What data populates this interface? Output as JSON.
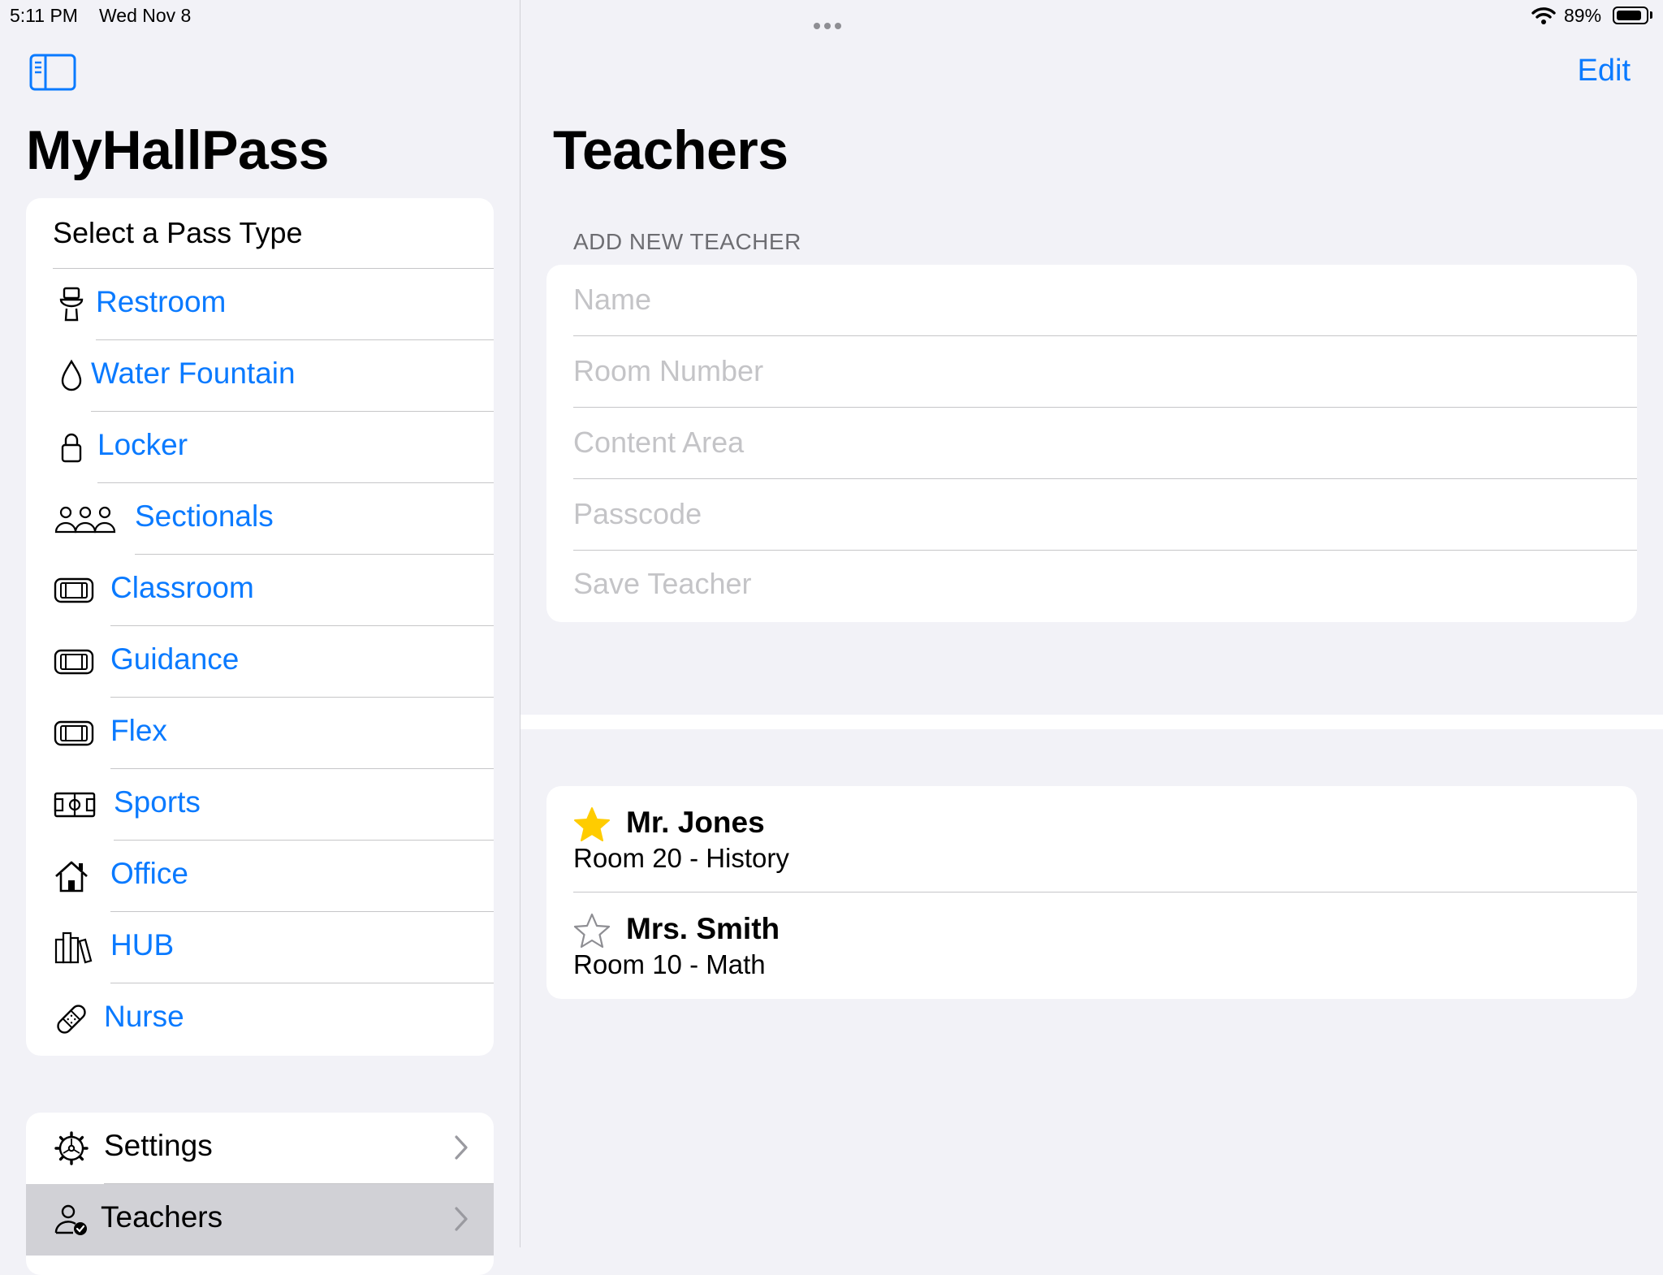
{
  "status_bar": {
    "time": "5:11 PM",
    "date": "Wed Nov 8",
    "battery_pct": "89%",
    "battery_level": 0.89
  },
  "sidebar": {
    "app_title": "MyHallPass",
    "pass_header": "Select a Pass Type",
    "pass_types": [
      {
        "label": "Restroom",
        "icon": "toilet-icon"
      },
      {
        "label": "Water Fountain",
        "icon": "drop-icon"
      },
      {
        "label": "Locker",
        "icon": "lock-icon"
      },
      {
        "label": "Sectionals",
        "icon": "group-icon"
      },
      {
        "label": "Classroom",
        "icon": "film-icon"
      },
      {
        "label": "Guidance",
        "icon": "film-icon"
      },
      {
        "label": "Flex",
        "icon": "film-icon"
      },
      {
        "label": "Sports",
        "icon": "sports-court-icon"
      },
      {
        "label": "Office",
        "icon": "house-icon"
      },
      {
        "label": "HUB",
        "icon": "books-icon"
      },
      {
        "label": "Nurse",
        "icon": "bandage-icon"
      }
    ],
    "nav": [
      {
        "label": "Settings",
        "icon": "gear-icon",
        "selected": false
      },
      {
        "label": "Teachers",
        "icon": "person-check-icon",
        "selected": true
      }
    ]
  },
  "main": {
    "edit_label": "Edit",
    "title": "Teachers",
    "add_section_header": "ADD NEW TEACHER",
    "form": {
      "name_placeholder": "Name",
      "room_placeholder": "Room Number",
      "content_placeholder": "Content Area",
      "passcode_placeholder": "Passcode",
      "save_label": "Save Teacher"
    },
    "teachers": [
      {
        "name": "Mr. Jones",
        "detail": "Room 20 - History",
        "favorite": true
      },
      {
        "name": "Mrs. Smith",
        "detail": "Room 10 - Math",
        "favorite": false
      }
    ]
  },
  "colors": {
    "accent": "#0a7aff",
    "favorite_star": "#ffcc00",
    "background": "#f2f2f7",
    "placeholder": "#c4c4c7"
  }
}
